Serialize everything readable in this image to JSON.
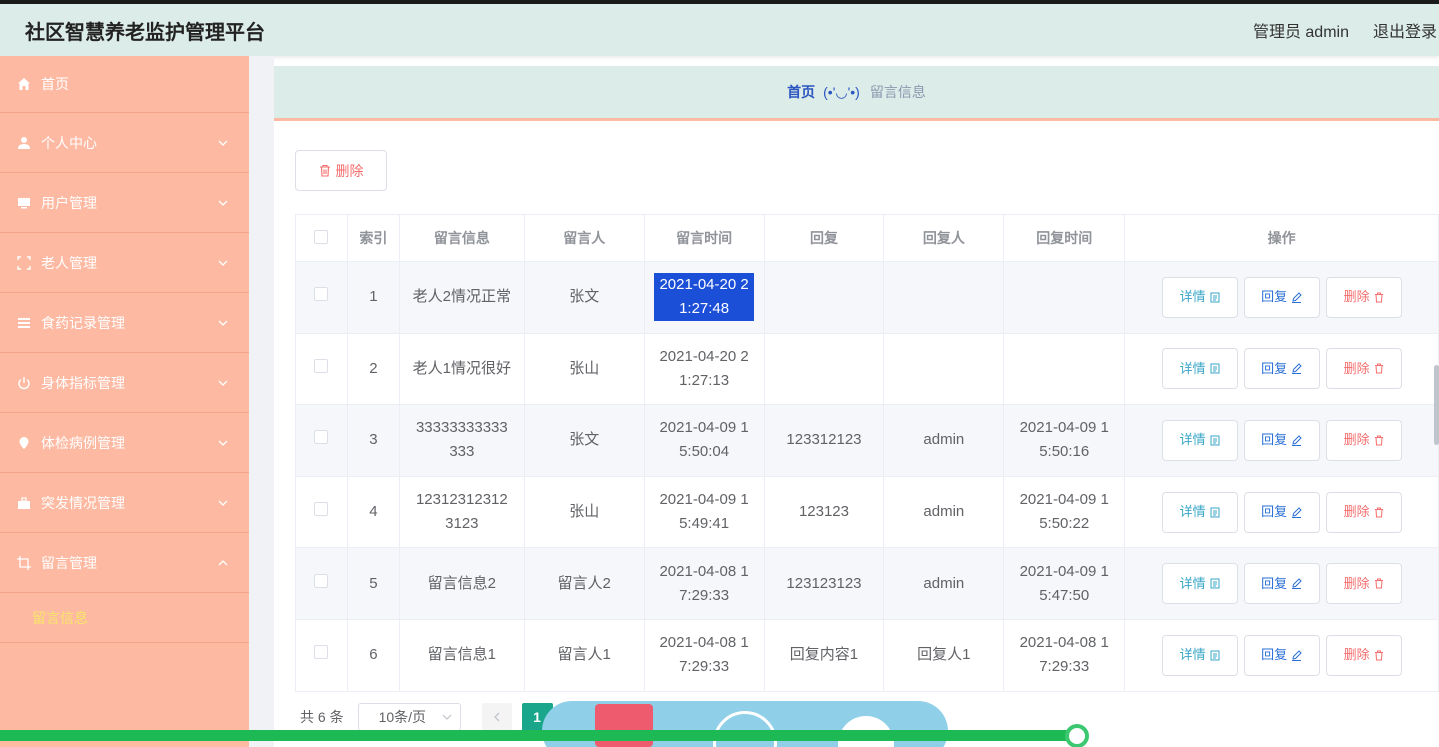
{
  "header": {
    "title": "社区智慧养老监护管理平台",
    "user": "管理员 admin",
    "logout": "退出登录"
  },
  "sidebar": {
    "items": [
      {
        "label": "首页",
        "icon": "home-icon"
      },
      {
        "label": "个人中心",
        "icon": "user-icon"
      },
      {
        "label": "用户管理",
        "icon": "monitor-icon"
      },
      {
        "label": "老人管理",
        "icon": "fullscreen-icon"
      },
      {
        "label": "食药记录管理",
        "icon": "list-icon"
      },
      {
        "label": "身体指标管理",
        "icon": "power-icon"
      },
      {
        "label": "体检病例管理",
        "icon": "location-icon"
      },
      {
        "label": "突发情况管理",
        "icon": "suitcase-icon"
      },
      {
        "label": "留言管理",
        "icon": "crop-icon"
      }
    ],
    "submenu": "留言信息"
  },
  "breadcrumb": {
    "home": "首页",
    "face": "(•'◡'•)",
    "current": "留言信息"
  },
  "toolbar": {
    "delete_label": "删除"
  },
  "table": {
    "headers": [
      "索引",
      "留言信息",
      "留言人",
      "留言时间",
      "回复",
      "回复人",
      "回复时间",
      "操作"
    ],
    "rows": [
      {
        "index": "1",
        "message": "老人2情况正常",
        "author": "张文",
        "time": "2021-04-20 21:27:48",
        "reply": "",
        "replier": "",
        "reply_time": ""
      },
      {
        "index": "2",
        "message": "老人1情况很好",
        "author": "张山",
        "time": "2021-04-20 21:27:13",
        "reply": "",
        "replier": "",
        "reply_time": ""
      },
      {
        "index": "3",
        "message": "33333333333333",
        "author": "张文",
        "time": "2021-04-09 15:50:04",
        "reply": "123312123",
        "replier": "admin",
        "reply_time": "2021-04-09 15:50:16"
      },
      {
        "index": "4",
        "message": "123123123123123",
        "author": "张山",
        "time": "2021-04-09 15:49:41",
        "reply": "123123",
        "replier": "admin",
        "reply_time": "2021-04-09 15:50:22"
      },
      {
        "index": "5",
        "message": "留言信息2",
        "author": "留言人2",
        "time": "2021-04-08 17:29:33",
        "reply": "123123123",
        "replier": "admin",
        "reply_time": "2021-04-09 15:47:50"
      },
      {
        "index": "6",
        "message": "留言信息1",
        "author": "留言人1",
        "time": "2021-04-08 17:29:33",
        "reply": "回复内容1",
        "replier": "回复人1",
        "reply_time": "2021-04-08 17:29:33"
      }
    ],
    "actions": {
      "detail": "详情",
      "reply": "回复",
      "delete": "删除"
    }
  },
  "pagination": {
    "total": "共 6 条",
    "page_size": "10条/页",
    "current_page": "1"
  },
  "colors": {
    "sidebar": "#fdb9a2",
    "header": "#dcece8",
    "accent": "#1aa68a",
    "danger": "#f56c6c"
  }
}
